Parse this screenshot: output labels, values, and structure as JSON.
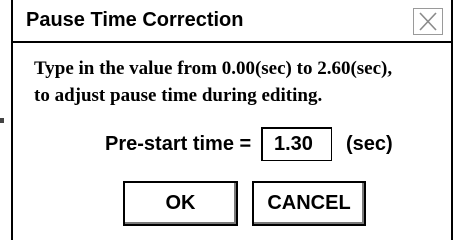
{
  "dialog": {
    "title": "Pause Time Correction",
    "close_icon": "close-x-icon",
    "message_line1": "Type in the value from 0.00(sec) to 2.60(sec),",
    "message_line2": "to adjust pause time during editing.",
    "field": {
      "label": "Pre-start time =",
      "value": "1.30",
      "unit": "(sec)"
    },
    "buttons": {
      "ok_label": "OK",
      "cancel_label": "CANCEL"
    }
  },
  "colors": {
    "background": "#ffffff",
    "border": "#000000",
    "close_border": "#9a9a9a"
  }
}
